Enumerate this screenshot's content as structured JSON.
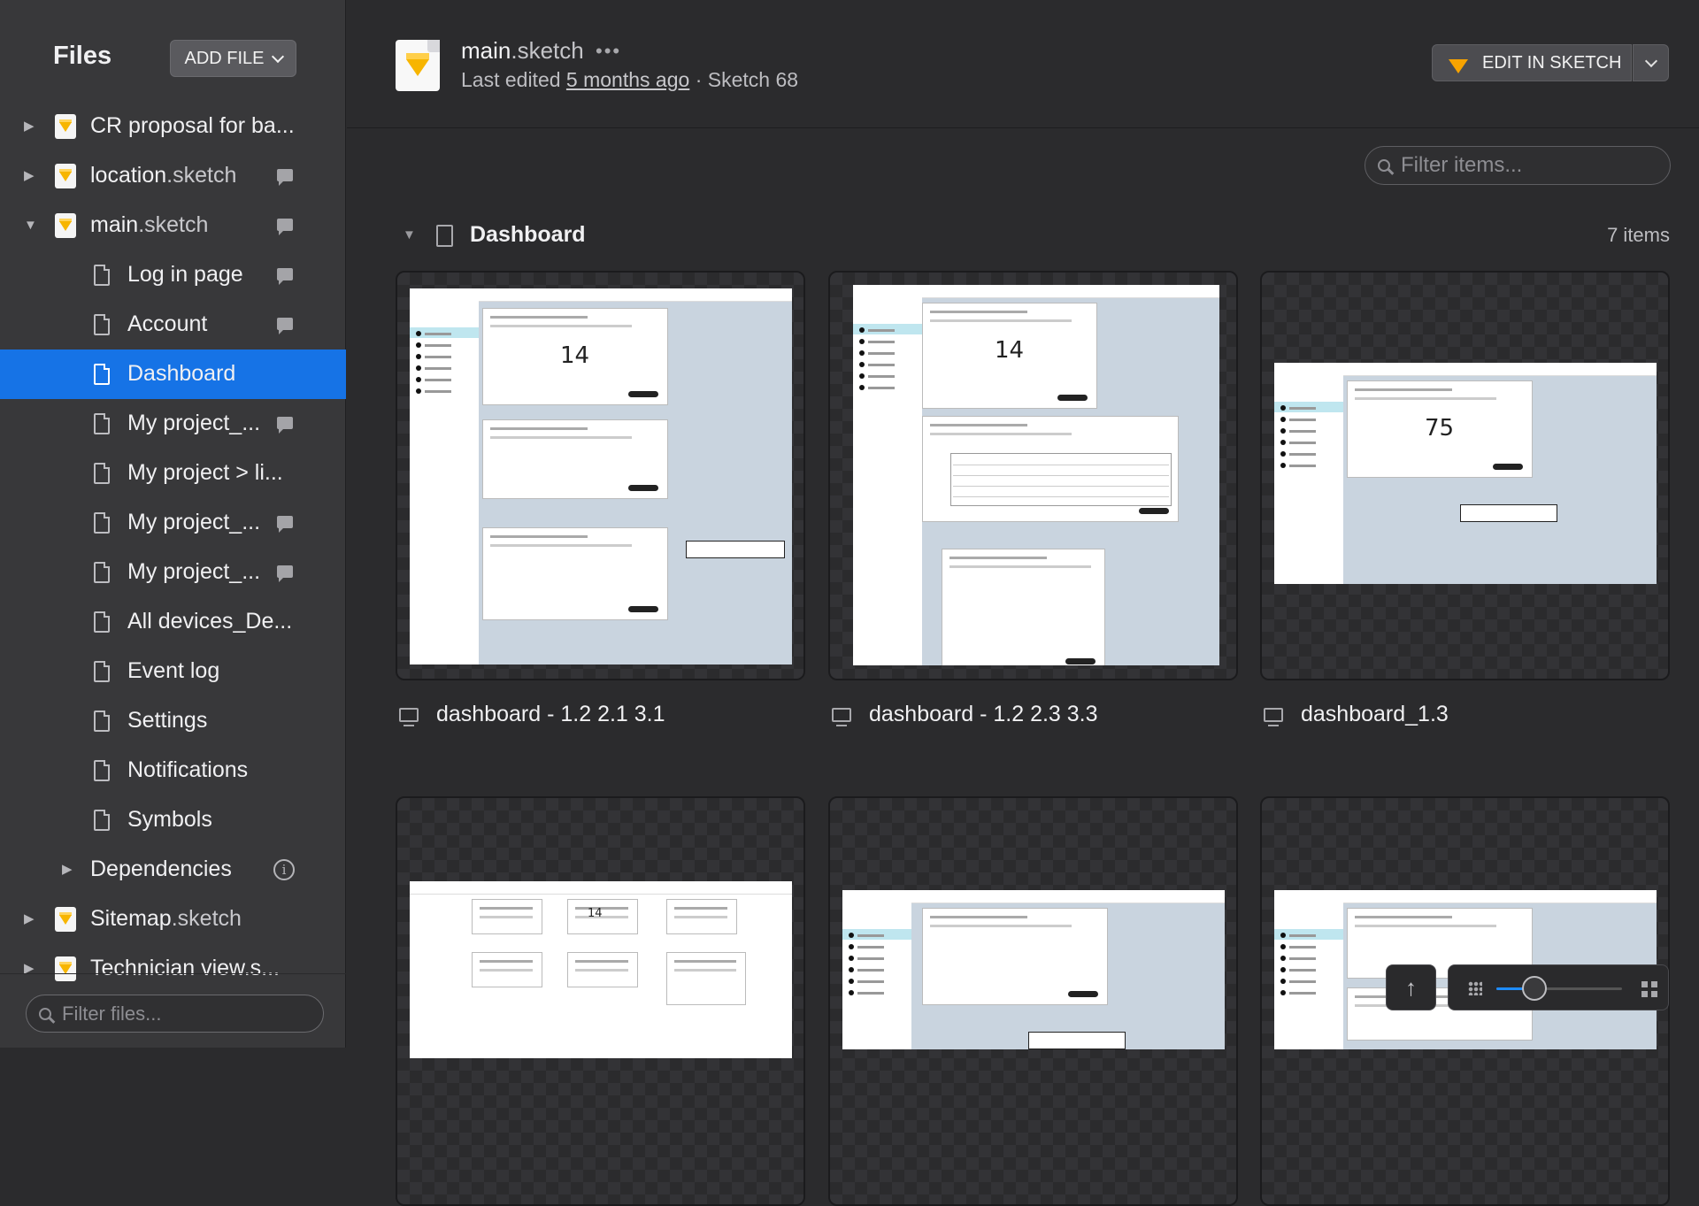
{
  "sidebar": {
    "title": "Files",
    "add_file_label": "ADD FILE",
    "items": [
      {
        "label": "CR proposal for ba...",
        "ext": "",
        "type": "sketch",
        "indent": 0,
        "caret": "right",
        "comment": false
      },
      {
        "label": "location",
        "ext": ".sketch",
        "type": "sketch",
        "indent": 0,
        "caret": "right",
        "comment": true
      },
      {
        "label": "main",
        "ext": ".sketch",
        "type": "sketch",
        "indent": 0,
        "caret": "down",
        "comment": true
      },
      {
        "label": "Log in page",
        "ext": "",
        "type": "page",
        "indent": 1,
        "caret": "",
        "comment": true
      },
      {
        "label": "Account",
        "ext": "",
        "type": "page",
        "indent": 1,
        "caret": "",
        "comment": true
      },
      {
        "label": "Dashboard",
        "ext": "",
        "type": "page",
        "indent": 1,
        "caret": "",
        "comment": false,
        "active": true
      },
      {
        "label": "My project_...",
        "ext": "",
        "type": "page",
        "indent": 1,
        "caret": "",
        "comment": true
      },
      {
        "label": "My project > li...",
        "ext": "",
        "type": "page",
        "indent": 1,
        "caret": "",
        "comment": false
      },
      {
        "label": "My project_...",
        "ext": "",
        "type": "page",
        "indent": 1,
        "caret": "",
        "comment": true
      },
      {
        "label": "My project_...",
        "ext": "",
        "type": "page",
        "indent": 1,
        "caret": "",
        "comment": true
      },
      {
        "label": "All devices_De...",
        "ext": "",
        "type": "page",
        "indent": 1,
        "caret": "",
        "comment": false
      },
      {
        "label": "Event log",
        "ext": "",
        "type": "page",
        "indent": 1,
        "caret": "",
        "comment": false
      },
      {
        "label": "Settings",
        "ext": "",
        "type": "page",
        "indent": 1,
        "caret": "",
        "comment": false
      },
      {
        "label": "Notifications",
        "ext": "",
        "type": "page",
        "indent": 1,
        "caret": "",
        "comment": false
      },
      {
        "label": "Symbols",
        "ext": "",
        "type": "page",
        "indent": 1,
        "caret": "",
        "comment": false
      },
      {
        "label": "Dependencies",
        "ext": "",
        "type": "deps",
        "indent": 1,
        "caret": "right",
        "comment": false
      },
      {
        "label": "Sitemap",
        "ext": ".sketch",
        "type": "sketch",
        "indent": 0,
        "caret": "right",
        "comment": false
      },
      {
        "label": "Technician view.s...",
        "ext": "",
        "type": "sketch",
        "indent": 0,
        "caret": "right",
        "comment": false
      }
    ],
    "filter_placeholder": "Filter files..."
  },
  "document": {
    "name": "main",
    "ext": ".sketch",
    "last_edited_prefix": "Last edited",
    "last_edited_link": "5 months ago",
    "separator": "·",
    "app_version": "Sketch 68",
    "edit_button": "EDIT IN SKETCH",
    "filter_placeholder": "Filter items..."
  },
  "section": {
    "title": "Dashboard",
    "count": "7 items"
  },
  "artboards": [
    {
      "name": "dashboard - 1.2 2.1 3.1",
      "big_number": "14"
    },
    {
      "name": "dashboard - 1.2 2.3 3.3",
      "big_number": "14"
    },
    {
      "name": "dashboard_1.3",
      "big_number": "75"
    },
    {
      "name": "",
      "big_number": "14"
    },
    {
      "name": "",
      "big_number": ""
    },
    {
      "name": "",
      "big_number": ""
    }
  ],
  "zoom": {
    "level": 0.3
  },
  "colors": {
    "accent": "#1673e6",
    "sketch_gem": "#f7b500",
    "sidebar_bg": "#38383a",
    "main_bg": "#2b2b2d"
  }
}
